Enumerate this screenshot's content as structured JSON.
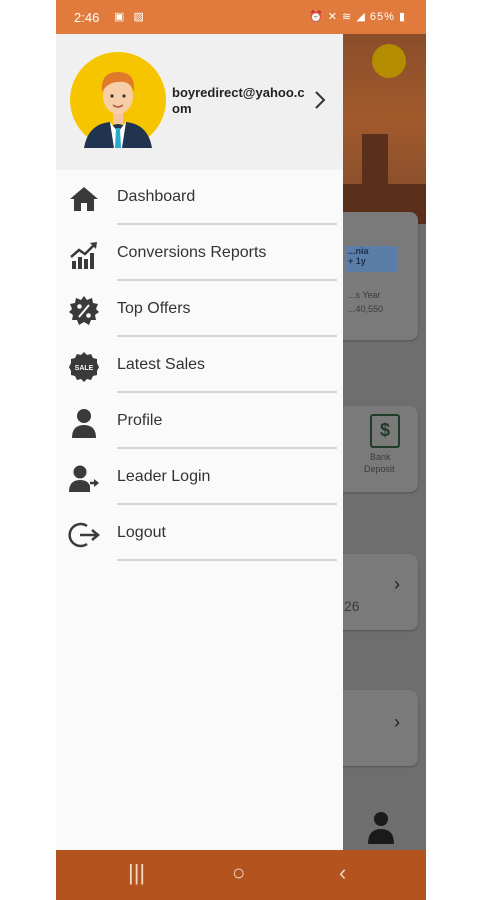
{
  "status_bar": {
    "time": "2:46",
    "notification_icons": [
      "photo-notification-icon",
      "gallery-notification-icon"
    ],
    "system_icons": [
      "alarm-icon",
      "mute-icon",
      "wifi-icon",
      "signal-icon"
    ],
    "battery": "65%"
  },
  "drawer": {
    "email": "boyredirect@yahoo.com",
    "menu": [
      {
        "label": "Dashboard",
        "icon": "home-icon"
      },
      {
        "label": "Conversions Reports",
        "icon": "trend-chart-icon"
      },
      {
        "label": "Top Offers",
        "icon": "percent-badge-icon"
      },
      {
        "label": "Latest Sales",
        "icon": "sale-tag-icon",
        "icon_text": "SALE"
      },
      {
        "label": "Profile",
        "icon": "person-icon"
      },
      {
        "label": "Leader Login",
        "icon": "person-arrow-icon"
      },
      {
        "label": "Logout",
        "icon": "logout-icon"
      }
    ]
  },
  "background": {
    "card1_text": "...nia",
    "card1_sub": "+ 1y",
    "card1_line2": "...s Year",
    "card1_value": "...40,550",
    "bank_label_1": "Bank",
    "bank_label_2": "Deposit",
    "number": "26"
  },
  "colors": {
    "status_bar": "#e07b3d",
    "nav_bar": "#b3531e",
    "drawer_bg": "#fafafa",
    "header_bg": "#f0f0f0"
  }
}
